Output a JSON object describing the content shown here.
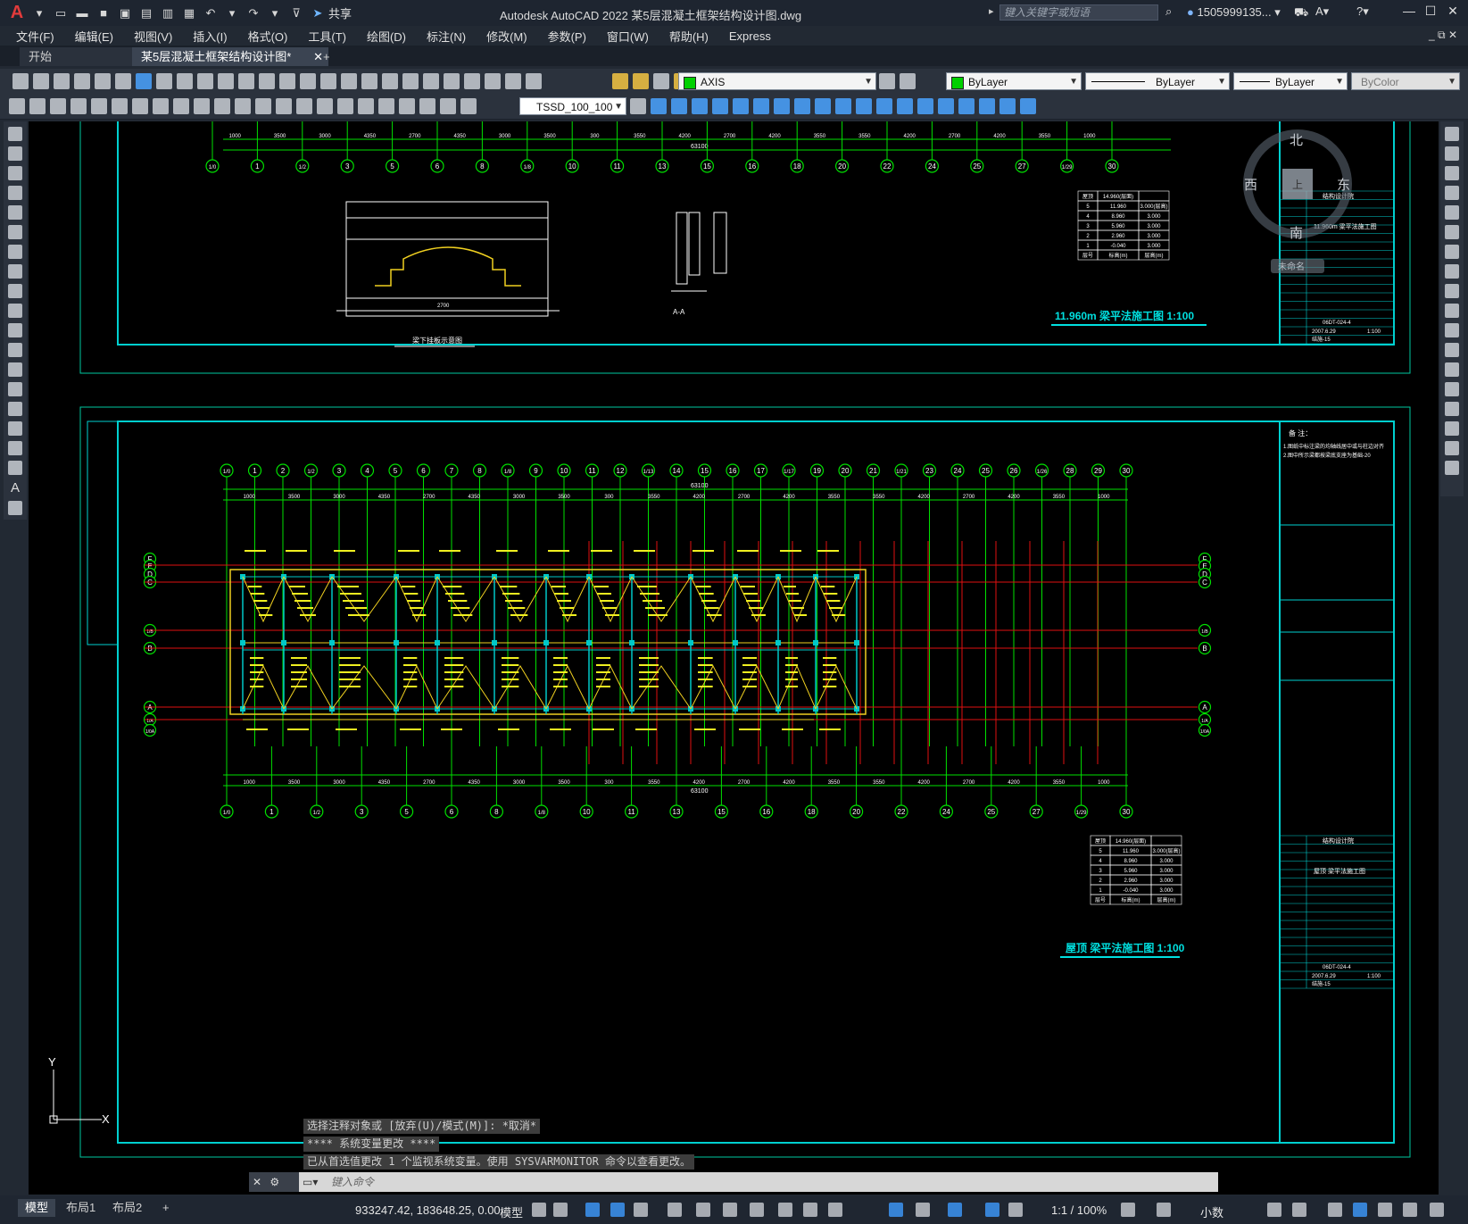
{
  "title_bar": {
    "app_title": "Autodesk AutoCAD 2022    某5层混凝土框架结构设计图.dwg",
    "share_label": "共享",
    "search_placeholder": "键入关键字或短语",
    "user_name": "1505999135..."
  },
  "menu": [
    "文件(F)",
    "编辑(E)",
    "视图(V)",
    "插入(I)",
    "格式(O)",
    "工具(T)",
    "绘图(D)",
    "标注(N)",
    "修改(M)",
    "参数(P)",
    "窗口(W)",
    "帮助(H)",
    "Express"
  ],
  "tabs": {
    "start": "开始",
    "document": "某5层混凝土框架结构设计图*",
    "add": "+"
  },
  "toolbar": {
    "layer": "AXIS",
    "color": "ByLayer",
    "linetype": "ByLayer",
    "lineweight": "ByLayer",
    "plotstyle": "ByColor",
    "dimstyle": "TSSD_100_100",
    "layer_color": "#00d000"
  },
  "compass": {
    "north": "北",
    "south": "南",
    "east": "东",
    "west": "西",
    "top": "上",
    "ucs": "未命名"
  },
  "drawing": {
    "top_title": "11.960m 梁平法施工图 1:100",
    "bottom_title": "屋顶 梁平法施工图 1:100",
    "section_label": "A-A",
    "detail_label": "梁下挂板示意图",
    "total_dim": "63100",
    "notes_title": "备 注：",
    "note1": "1.图纸中标注梁的均轴线居中或与柱边对齐",
    "note2": "2.图中所示梁都按梁底支座为基础-20",
    "design_unit": "结构设计院",
    "drawing_no": "06DT-024-4",
    "date": "2007.6.29",
    "scale": "1:100",
    "sheet": "结施-15",
    "top_sheet_name": "11.960m 梁平法施工图",
    "bottom_sheet_name": "屋顶 梁平法施工图",
    "top_axes": [
      "1/0",
      "1",
      "1/2",
      "3",
      "5",
      "6",
      "8",
      "1/8",
      "10",
      "11",
      "13",
      "15",
      "16",
      "18",
      "20",
      "22",
      "24",
      "25",
      "27",
      "1/29",
      "30"
    ],
    "plan_axes": [
      "1/0",
      "1",
      "2",
      "1/2",
      "3",
      "4",
      "5",
      "6",
      "7",
      "8",
      "1/8",
      "9",
      "10",
      "11",
      "12",
      "1/13",
      "14",
      "15",
      "16",
      "17",
      "1/17",
      "19",
      "20",
      "21",
      "1/21",
      "23",
      "24",
      "25",
      "26",
      "1/26",
      "28",
      "29",
      "30"
    ],
    "row_axes": [
      "F",
      "E",
      "D",
      "C",
      "1/B",
      "B",
      "A",
      "1/A",
      "1/0A"
    ],
    "top_dims": [
      "1000",
      "3500",
      "3000",
      "4350",
      "2700",
      "4350",
      "3000",
      "3500",
      "300",
      "3550",
      "4200",
      "2700",
      "4200",
      "3550",
      "3550",
      "4200",
      "2700",
      "4200",
      "3550",
      "1000"
    ],
    "level_table": [
      [
        "屋顶",
        "14.960(层面)",
        ""
      ],
      [
        "5",
        "11.960",
        "3.000(层高)"
      ],
      [
        "4",
        "8.960",
        "3.000"
      ],
      [
        "3",
        "5.960",
        "3.000"
      ],
      [
        "2",
        "2.960",
        "3.000"
      ],
      [
        "1",
        "-0.040",
        "3.000"
      ],
      [
        "层号",
        "标高(m)",
        "层高(m)"
      ]
    ]
  },
  "command_history": [
    "选择注释对象或 [放弃(U)/模式(M)]: *取消*",
    "**** 系统变量更改 ****",
    "已从首选值更改 1 个监视系统变量。使用 SYSVARMONITOR 命令以查看更改。"
  ],
  "command_placeholder": "键入命令",
  "status": {
    "layout_tabs": [
      "模型",
      "布局1",
      "布局2"
    ],
    "coords": "933247.42, 183648.25, 0.00",
    "model": "模型",
    "scale": "1:1 / 100%",
    "units": "小数"
  },
  "ucs": {
    "y": "Y",
    "x": "X"
  }
}
